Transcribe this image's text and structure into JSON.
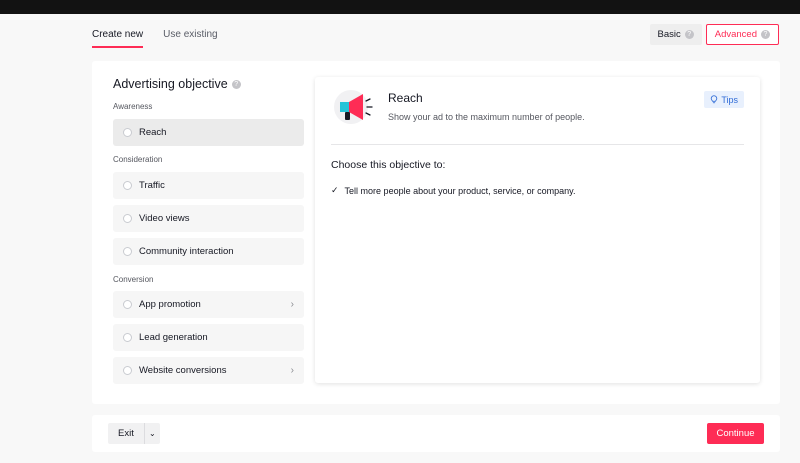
{
  "tabs": {
    "create_new": "Create new",
    "use_existing": "Use existing"
  },
  "mode": {
    "basic": "Basic",
    "advanced": "Advanced"
  },
  "objective": {
    "title": "Advertising objective",
    "sections": {
      "awareness": "Awareness",
      "consideration": "Consideration",
      "conversion": "Conversion"
    },
    "options": {
      "reach": "Reach",
      "traffic": "Traffic",
      "video_views": "Video views",
      "community_interaction": "Community interaction",
      "app_promotion": "App promotion",
      "lead_generation": "Lead generation",
      "website_conversions": "Website conversions"
    },
    "selected": "Reach"
  },
  "detail": {
    "title": "Reach",
    "description": "Show your ad to the maximum number of people.",
    "tips_label": "Tips",
    "choose_heading": "Choose this objective to:",
    "benefits": [
      "Tell more people about your product, service, or company."
    ]
  },
  "footer": {
    "exit_label": "Exit",
    "continue_label": "Continue"
  },
  "colors": {
    "accent": "#fe2c55",
    "tips": "#2f6bd6"
  },
  "icons": [
    "help-icon",
    "megaphone-icon",
    "lightbulb-icon",
    "check-icon",
    "chevron-right-icon",
    "chevron-down-icon"
  ]
}
